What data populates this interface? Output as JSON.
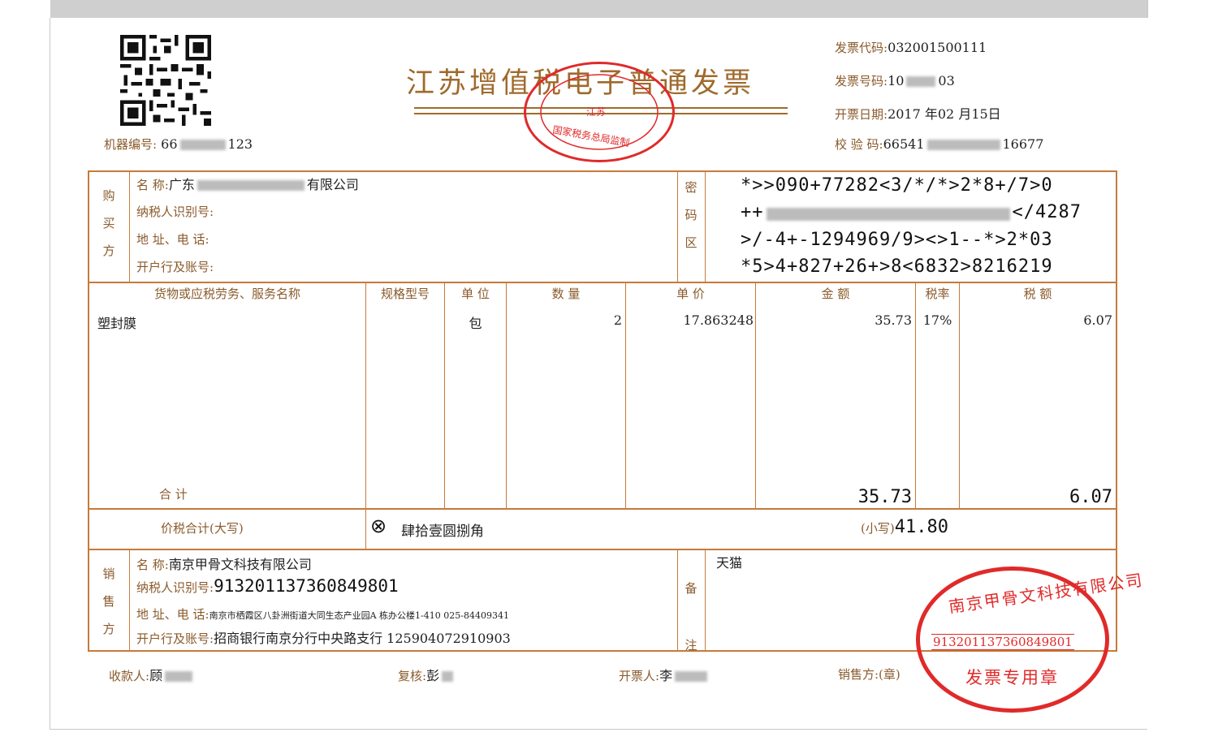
{
  "invoice": {
    "title": "江苏增值税电子普通发票",
    "machine_no_label": "机器编号:",
    "machine_no_prefix": "66",
    "machine_no_suffix": "123",
    "code_label": "发票代码:",
    "code_value": "032001500111",
    "number_label": "发票号码:",
    "number_prefix": "10",
    "number_suffix": "03",
    "date_label": "开票日期:",
    "date_value": "2017 年02 月15日",
    "check_label": "校 验 码:",
    "check_prefix": "66541",
    "check_suffix": "16677"
  },
  "buyer": {
    "side_chars": [
      "购",
      "买",
      "方"
    ],
    "name_label": "名          称:",
    "name_prefix": "广东",
    "name_suffix": "有限公司",
    "taxid_label": "纳税人识别号:",
    "address_label": "地  址、电  话:",
    "bank_label": "开户行及账号:"
  },
  "cipher": {
    "side_chars": [
      "密",
      "码",
      "区"
    ],
    "line1": "*>>090+77282<3/*/*>2*8+/7>0",
    "line2_prefix": "++",
    "line2_suffix": "</4287",
    "line3": ">/-4+-1294969/9><>1--*>2*03",
    "line4": "*5>4+827+26+>8<6832>8216219"
  },
  "columns": {
    "item": "货物或应税劳务、服务名称",
    "spec": "规格型号",
    "unit": "单 位",
    "qty": "数  量",
    "price": "单  价",
    "amount": "金    额",
    "rate": "税率",
    "tax": "税    额"
  },
  "items": [
    {
      "name": "塑封膜",
      "spec": "",
      "unit": "包",
      "qty": "2",
      "price": "17.863248",
      "amount": "35.73",
      "rate": "17%",
      "tax": "6.07"
    }
  ],
  "totals": {
    "label": "合          计",
    "amount": "35.73",
    "tax": "6.07",
    "grand_label": "价税合计(大写)",
    "grand_symbol": "⊗",
    "grand_upper": "肆拾壹圆捌角",
    "small_label": "(小写)",
    "small_value": "41.80"
  },
  "seller": {
    "side_chars": [
      "销",
      "售",
      "方"
    ],
    "name_label": "名          称:",
    "name_value": "南京甲骨文科技有限公司",
    "taxid_label": "纳税人识别号:",
    "taxid_value": "913201137360849801",
    "address_label": "地  址、电  话:",
    "address_value": "南京市栖霞区八卦洲街道大同生态产业园A 栋办公楼1-410 025-84409341",
    "bank_label": "开户行及账号:",
    "bank_value": "招商银行南京分行中央路支行 125904072910903"
  },
  "remarks": {
    "side_chars": [
      "备",
      "注"
    ],
    "value": "天猫"
  },
  "footer": {
    "payee_label": "收款人:",
    "payee_value": "顾",
    "reviewer_label": "复核:",
    "reviewer_value": "彭",
    "drawer_label": "开票人:",
    "drawer_value": "李",
    "seller_seal_label": "销售方:(章)"
  },
  "seals": {
    "tax_bureau_text": "国家税务总局监制",
    "tax_bureau_mid": "江苏",
    "company_name": "南京甲骨文科技有限公司",
    "company_taxid": "913201137360849801",
    "company_label": "发票专用章"
  },
  "colors": {
    "line": "#c77a3a",
    "label": "#8a5a2b",
    "stamp": "#e02a2a"
  }
}
